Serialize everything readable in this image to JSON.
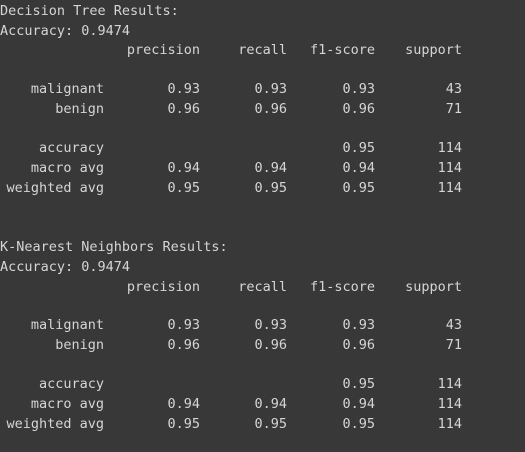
{
  "reports": [
    {
      "title": "Decision Tree Results:",
      "accuracy_line": "Accuracy: 0.9474",
      "headers": [
        "precision",
        "recall",
        "f1-score",
        "support"
      ],
      "rows": [
        {
          "label": "malignant",
          "precision": "0.93",
          "recall": "0.93",
          "f1": "0.93",
          "support": "43"
        },
        {
          "label": "benign",
          "precision": "0.96",
          "recall": "0.96",
          "f1": "0.96",
          "support": "71"
        }
      ],
      "summary": [
        {
          "label": "accuracy",
          "precision": "",
          "recall": "",
          "f1": "0.95",
          "support": "114"
        },
        {
          "label": "macro avg",
          "precision": "0.94",
          "recall": "0.94",
          "f1": "0.94",
          "support": "114"
        },
        {
          "label": "weighted avg",
          "precision": "0.95",
          "recall": "0.95",
          "f1": "0.95",
          "support": "114"
        }
      ]
    },
    {
      "title": "K-Nearest Neighbors Results:",
      "accuracy_line": "Accuracy: 0.9474",
      "headers": [
        "precision",
        "recall",
        "f1-score",
        "support"
      ],
      "rows": [
        {
          "label": "malignant",
          "precision": "0.93",
          "recall": "0.93",
          "f1": "0.93",
          "support": "43"
        },
        {
          "label": "benign",
          "precision": "0.96",
          "recall": "0.96",
          "f1": "0.96",
          "support": "71"
        }
      ],
      "summary": [
        {
          "label": "accuracy",
          "precision": "",
          "recall": "",
          "f1": "0.95",
          "support": "114"
        },
        {
          "label": "macro avg",
          "precision": "0.94",
          "recall": "0.94",
          "f1": "0.94",
          "support": "114"
        },
        {
          "label": "weighted avg",
          "precision": "0.95",
          "recall": "0.95",
          "f1": "0.95",
          "support": "114"
        }
      ]
    }
  ]
}
